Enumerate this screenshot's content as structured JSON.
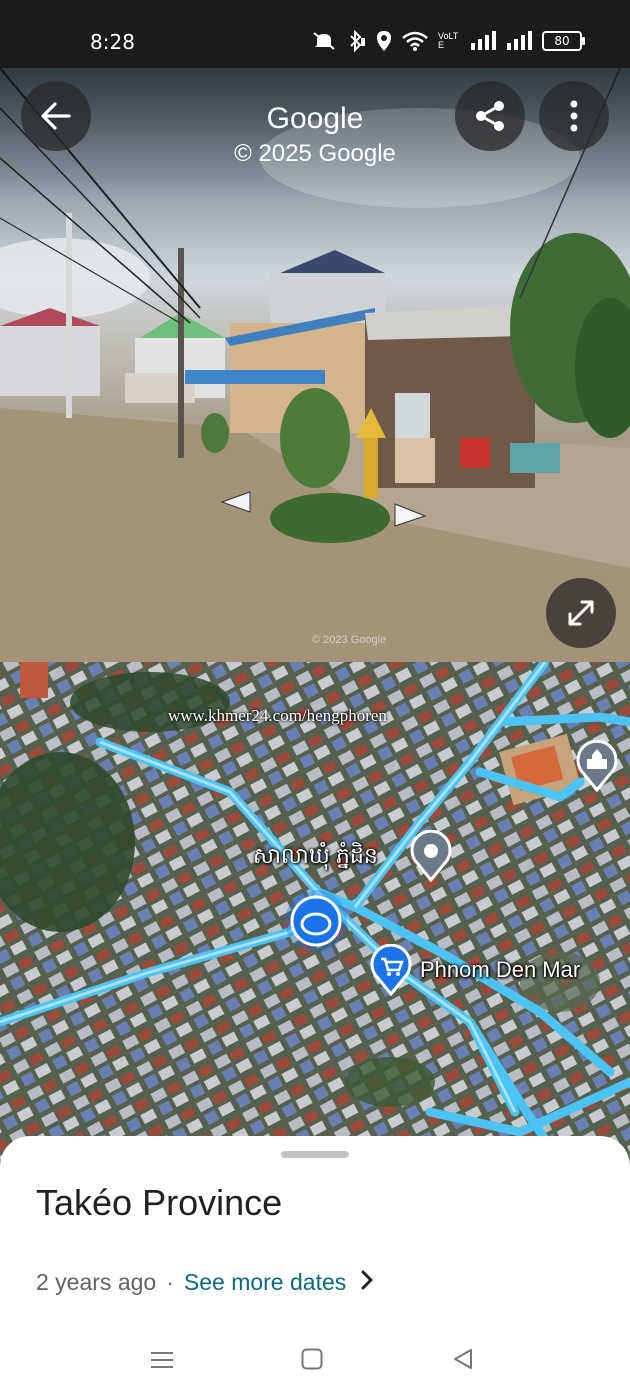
{
  "status_bar": {
    "time": "8:28",
    "network_label": "VoLTE",
    "battery": "80"
  },
  "header": {
    "title": "Google",
    "subtitle": "© 2025 Google"
  },
  "street_view": {
    "imagery_watermark": "© 2023 Google"
  },
  "map": {
    "watermark": "www.khmer24.com/hengphoren",
    "labels": {
      "commune": "សាលាឃុំ ភ្នំដិន",
      "market": "Phnom Den Mar"
    }
  },
  "sheet": {
    "title": "Takéo Province",
    "date_ago": "2 years ago",
    "separator": "·",
    "see_more": "See more dates"
  },
  "colors": {
    "road": "#4cc3f2",
    "accent_link": "#0b6b78",
    "location_dot": "#1a73e8"
  },
  "icons": [
    "back-arrow-icon",
    "share-icon",
    "more-vert-icon",
    "expand-icon",
    "location-pin-icon",
    "shopping-cart-icon",
    "temple-icon",
    "chevron-right-icon",
    "menu-icon",
    "home-square-icon",
    "back-triangle-icon"
  ]
}
